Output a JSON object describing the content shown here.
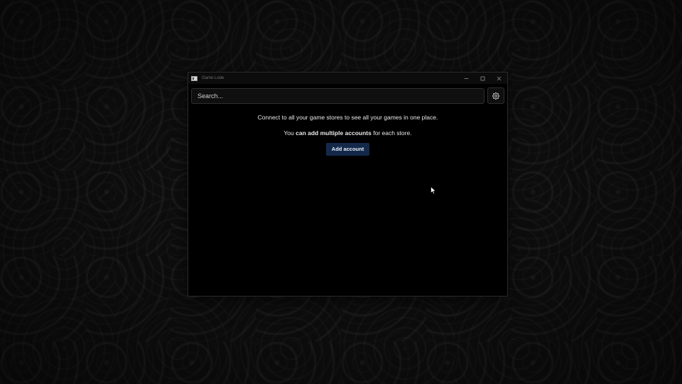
{
  "window": {
    "title": "Game Lode"
  },
  "search": {
    "placeholder": "Search..."
  },
  "icons": {
    "app": "app-icon",
    "minimize": "minimize-icon",
    "maximize": "maximize-icon",
    "close": "close-icon",
    "settings": "gear-icon",
    "cursor": "mouse-pointer-icon"
  },
  "empty_state": {
    "line1": "Connect to all your game stores to see all your games in one place.",
    "line2_prefix": "You ",
    "line2_bold": "can add multiple accounts",
    "line2_suffix": " for each store.",
    "add_account_label": "Add account"
  },
  "colors": {
    "window_bg": "#000000",
    "accent_button": "#14294a"
  }
}
